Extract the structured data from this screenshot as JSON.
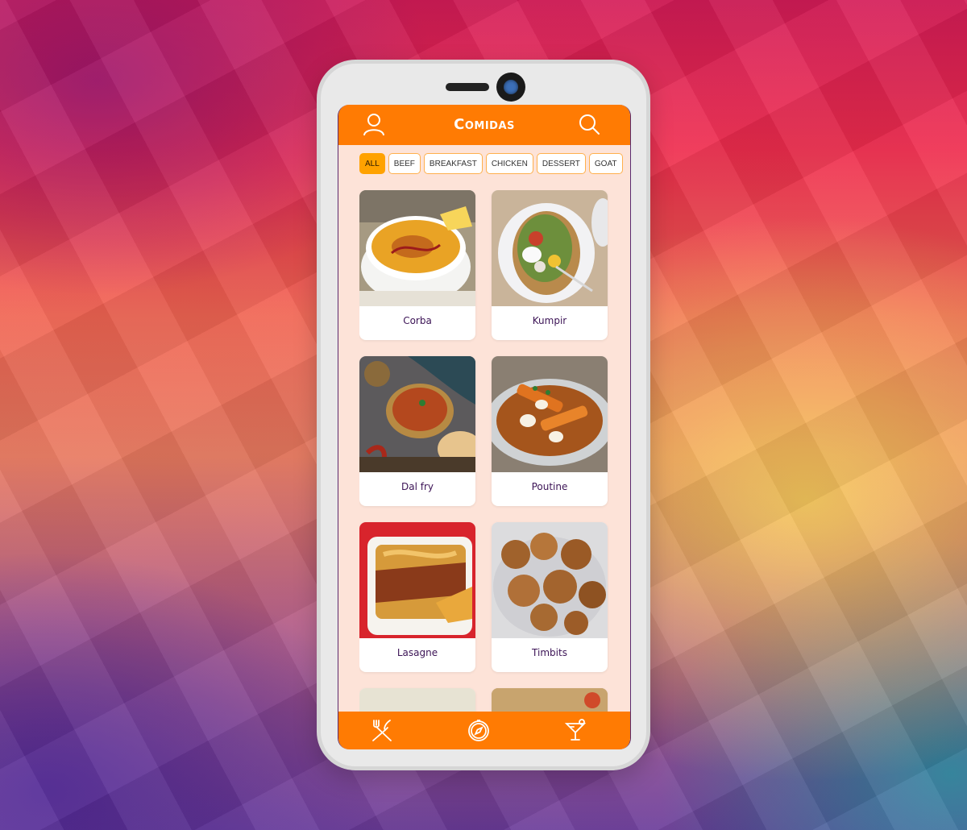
{
  "header": {
    "title": "Comidas",
    "user_icon": "user-icon",
    "search_icon": "search-icon"
  },
  "filters": [
    {
      "label": "ALL",
      "active": true
    },
    {
      "label": "BEEF",
      "active": false
    },
    {
      "label": "BREAKFAST",
      "active": false
    },
    {
      "label": "CHICKEN",
      "active": false
    },
    {
      "label": "DESSERT",
      "active": false
    },
    {
      "label": "GOAT",
      "active": false
    }
  ],
  "meals": [
    {
      "name": "Corba"
    },
    {
      "name": "Kumpir"
    },
    {
      "name": "Dal fry"
    },
    {
      "name": "Poutine"
    },
    {
      "name": "Lasagne"
    },
    {
      "name": "Timbits"
    },
    {
      "name": ""
    },
    {
      "name": ""
    }
  ],
  "bottom_nav": [
    {
      "icon": "fork-knife-icon"
    },
    {
      "icon": "compass-icon"
    },
    {
      "icon": "cocktail-icon"
    }
  ],
  "colors": {
    "accent": "#ff7b03",
    "screen_bg": "#fde3d8",
    "chip_active": "#ffa200",
    "label_text": "#3c1456"
  }
}
